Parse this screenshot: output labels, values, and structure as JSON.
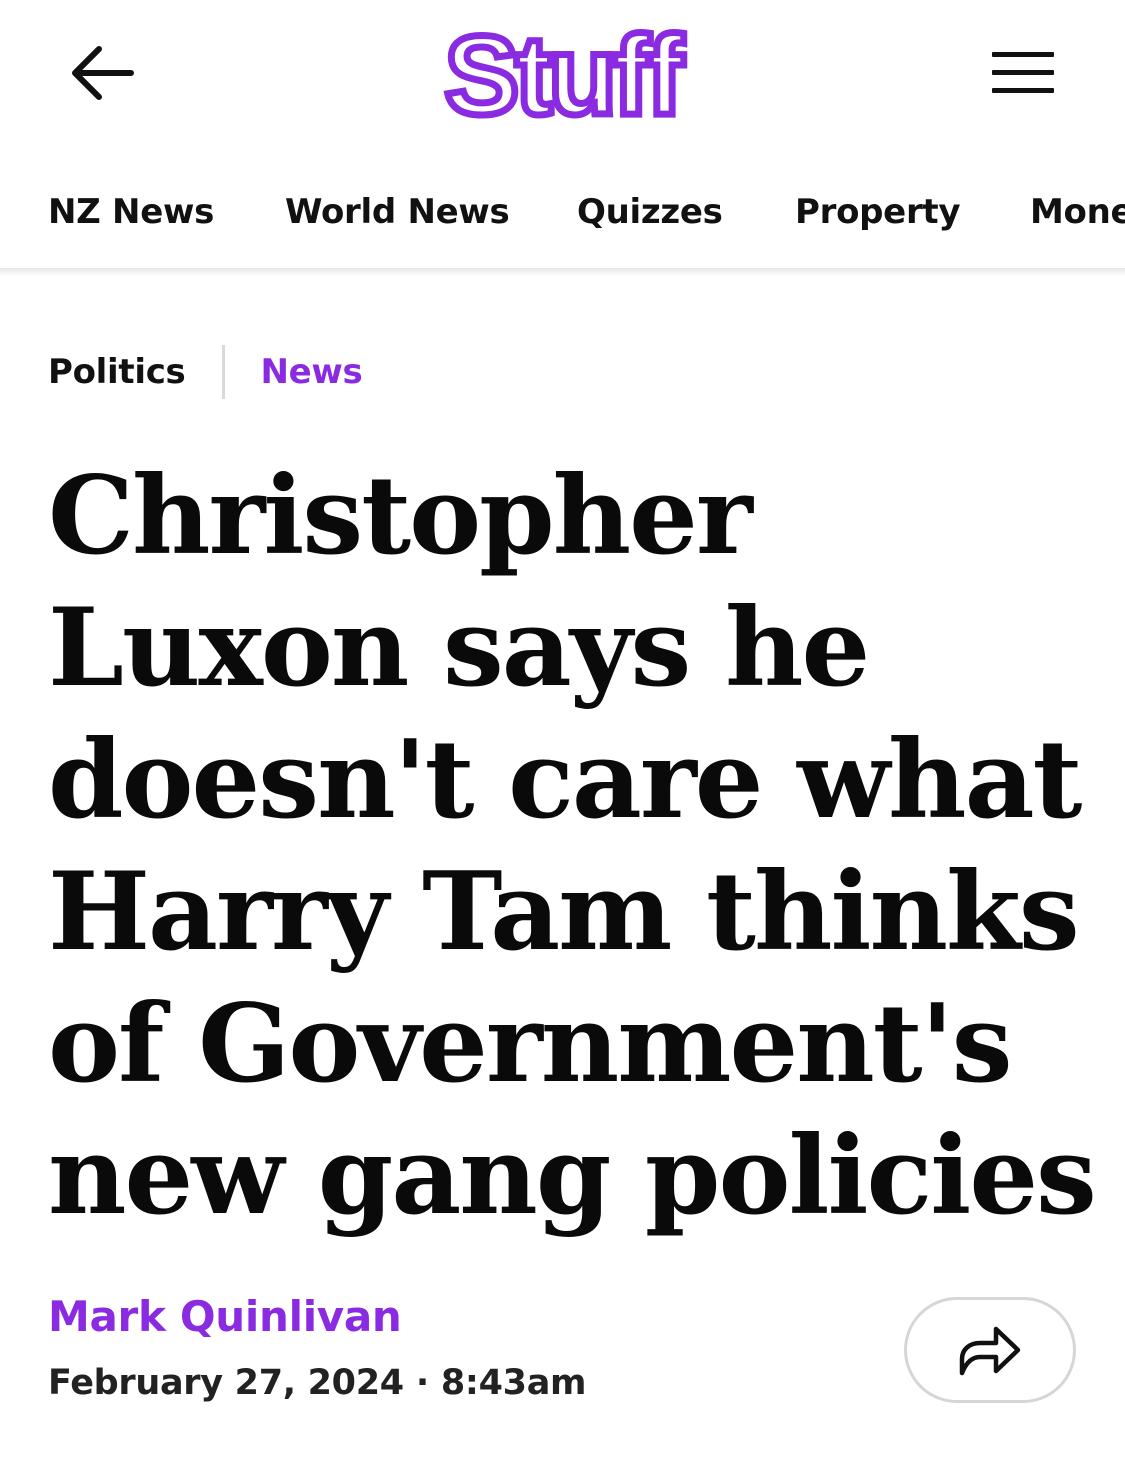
{
  "header": {
    "logo_text": "Stuff",
    "brand_color": "#8a2be2",
    "back_icon": "arrow-left-icon",
    "menu_icon": "hamburger-menu-icon"
  },
  "nav": {
    "items": [
      {
        "label": "NZ News"
      },
      {
        "label": "World News"
      },
      {
        "label": "Quizzes"
      },
      {
        "label": "Property"
      },
      {
        "label": "Mone"
      }
    ]
  },
  "article": {
    "section": "Politics",
    "category": "News",
    "headline": "Christopher Luxon says he doesn't care what Harry Tam thinks of Government's new gang policies",
    "author": "Mark Quinlivan",
    "date": "February 27, 2024",
    "date_separator": "·",
    "time": "8:43am",
    "share_icon": "share-arrow-icon"
  }
}
